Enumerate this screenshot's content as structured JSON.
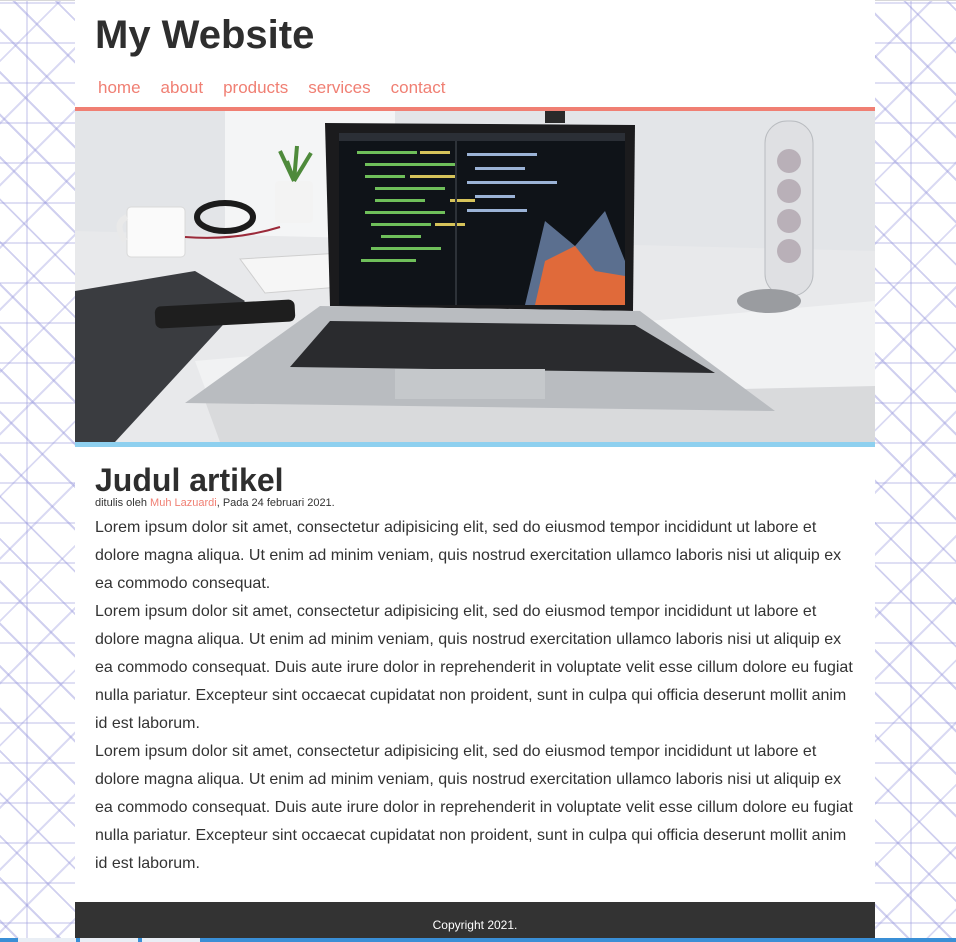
{
  "site": {
    "title": "My Website"
  },
  "nav": {
    "items": [
      {
        "label": "home"
      },
      {
        "label": "about"
      },
      {
        "label": "products"
      },
      {
        "label": "services"
      },
      {
        "label": "contact"
      }
    ]
  },
  "colors": {
    "accent": "#f07f73",
    "hero_bar": "#8ed0ef",
    "footer_bg": "#333333"
  },
  "hero": {
    "image": "laptop-on-desk-photo"
  },
  "article": {
    "title": "Judul artikel",
    "meta_prefix": "ditulis oleh ",
    "author": "Muh Lazuardi",
    "meta_suffix": ", Pada 24 februari 2021.",
    "paragraphs": [
      "Lorem ipsum dolor sit amet, consectetur adipisicing elit, sed do eiusmod tempor incididunt ut labore et dolore magna aliqua. Ut enim ad minim veniam, quis nostrud exercitation ullamco laboris nisi ut aliquip ex ea commodo consequat.",
      "Lorem ipsum dolor sit amet, consectetur adipisicing elit, sed do eiusmod tempor incididunt ut labore et dolore magna aliqua. Ut enim ad minim veniam, quis nostrud exercitation ullamco laboris nisi ut aliquip ex ea commodo consequat. Duis aute irure dolor in reprehenderit in voluptate velit esse cillum dolore eu fugiat nulla pariatur. Excepteur sint occaecat cupidatat non proident, sunt in culpa qui officia deserunt mollit anim id est laborum.",
      "Lorem ipsum dolor sit amet, consectetur adipisicing elit, sed do eiusmod tempor incididunt ut labore et dolore magna aliqua. Ut enim ad minim veniam, quis nostrud exercitation ullamco laboris nisi ut aliquip ex ea commodo consequat. Duis aute irure dolor in reprehenderit in voluptate velit esse cillum dolore eu fugiat nulla pariatur. Excepteur sint occaecat cupidatat non proident, sunt in culpa qui officia deserunt mollit anim id est laborum."
    ]
  },
  "footer": {
    "text": "Copyright 2021."
  }
}
